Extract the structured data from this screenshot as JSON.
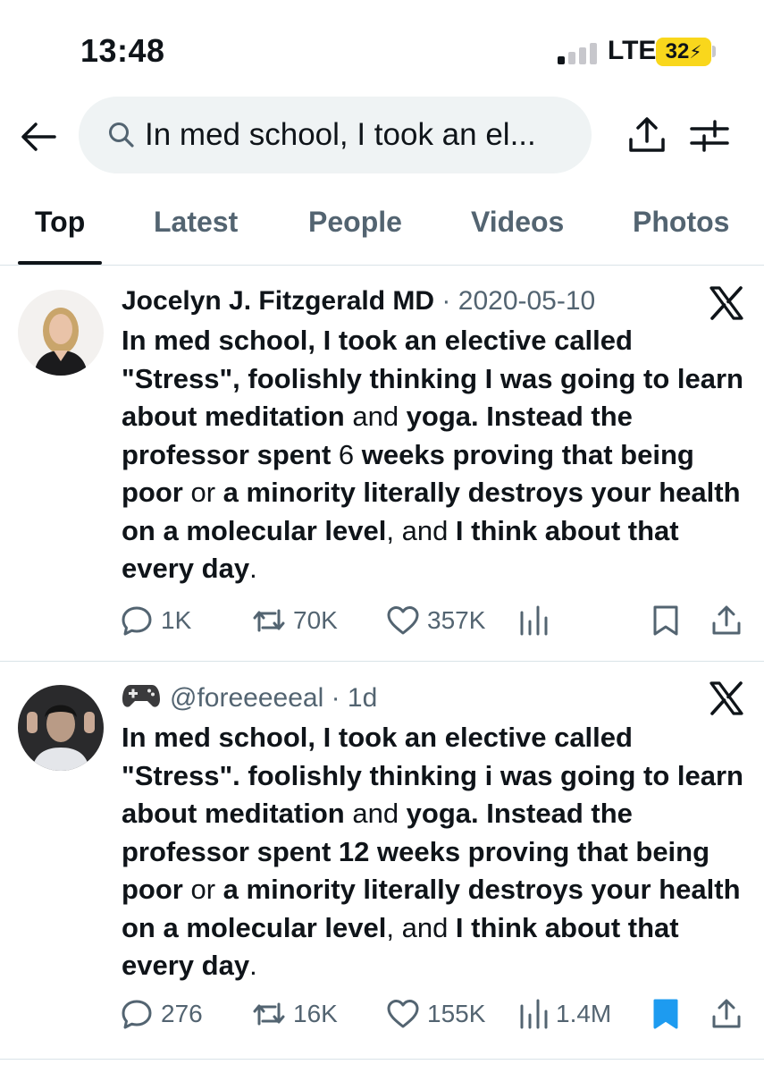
{
  "status_bar": {
    "time": "13:48",
    "network": "LTE",
    "battery": "32"
  },
  "header": {
    "search_query": "In med school, I took an el..."
  },
  "tabs": [
    {
      "label": "Top",
      "active": true
    },
    {
      "label": "Latest",
      "active": false
    },
    {
      "label": "People",
      "active": false
    },
    {
      "label": "Videos",
      "active": false
    },
    {
      "label": "Photos",
      "active": false
    }
  ],
  "posts": [
    {
      "author": "Jocelyn J. Fitzgerald MD",
      "sep": " · ",
      "date": "2020-05-10",
      "segments": [
        {
          "t": "In med school, I took an elective called \"Stress\", foolishly thinking I was going to learn about meditation",
          "b": true
        },
        {
          "t": " and ",
          "b": false
        },
        {
          "t": "yoga. Instead the professor spent",
          "b": true
        },
        {
          "t": " 6 ",
          "b": false
        },
        {
          "t": "weeks proving that being poor",
          "b": true
        },
        {
          "t": " or ",
          "b": false
        },
        {
          "t": "a minority literally destroys your health on a molecular level",
          "b": true
        },
        {
          "t": ", and ",
          "b": false
        },
        {
          "t": "I think about that every day",
          "b": true
        },
        {
          "t": ".",
          "b": false
        }
      ],
      "replies": "1K",
      "reposts": "70K",
      "likes": "357K",
      "views": "",
      "bookmarked": false
    },
    {
      "author": "@foreeeeeal",
      "sep": " · ",
      "date": "1d",
      "segments": [
        {
          "t": "In med school, I took an elective called \"Stress\". foolishly thinking i was going to learn about meditation",
          "b": true
        },
        {
          "t": " and ",
          "b": false
        },
        {
          "t": "yoga. Instead the professor spent 12 weeks proving that being poor",
          "b": true
        },
        {
          "t": " or ",
          "b": false
        },
        {
          "t": "a minority literally destroys your health on a molecular level",
          "b": true
        },
        {
          "t": ", and ",
          "b": false
        },
        {
          "t": "I think about that every day",
          "b": true
        },
        {
          "t": ".",
          "b": false
        }
      ],
      "replies": "276",
      "reposts": "16K",
      "likes": "155K",
      "views": "1.4M",
      "bookmarked": true
    }
  ],
  "colors": {
    "accent": "#1d9bf0",
    "text": "#0f1419",
    "muted": "#536471",
    "battery": "#f9d71c"
  }
}
